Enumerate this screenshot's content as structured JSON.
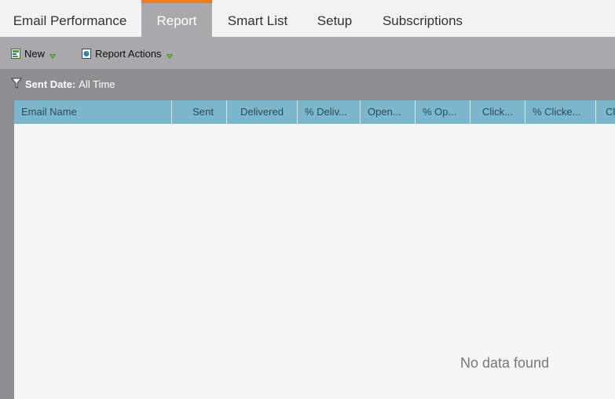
{
  "tabs": [
    {
      "label": "Email Performance",
      "active": false
    },
    {
      "label": "Report",
      "active": true
    },
    {
      "label": "Smart List",
      "active": false
    },
    {
      "label": "Setup",
      "active": false
    },
    {
      "label": "Subscriptions",
      "active": false
    }
  ],
  "toolbar": {
    "new_label": "New",
    "new_icon": "new-report-icon",
    "actions_label": "Report Actions",
    "actions_icon": "report-actions-icon",
    "caret_icon": "caret-down-icon"
  },
  "filter": {
    "label": "Sent Date:",
    "value": "All Time",
    "icon": "filter-icon"
  },
  "table": {
    "columns": [
      "Email Name",
      "Sent",
      "Delivered",
      "% Deliv...",
      "Open...",
      "% Op...",
      "Click...",
      "% Clicke...",
      "Cl"
    ],
    "empty_message": "No data found"
  },
  "colors": {
    "accent": "#ef7b1f",
    "header": "#7bb6cc",
    "toolbar": "#a9a8ad",
    "background": "#8e8d92"
  }
}
